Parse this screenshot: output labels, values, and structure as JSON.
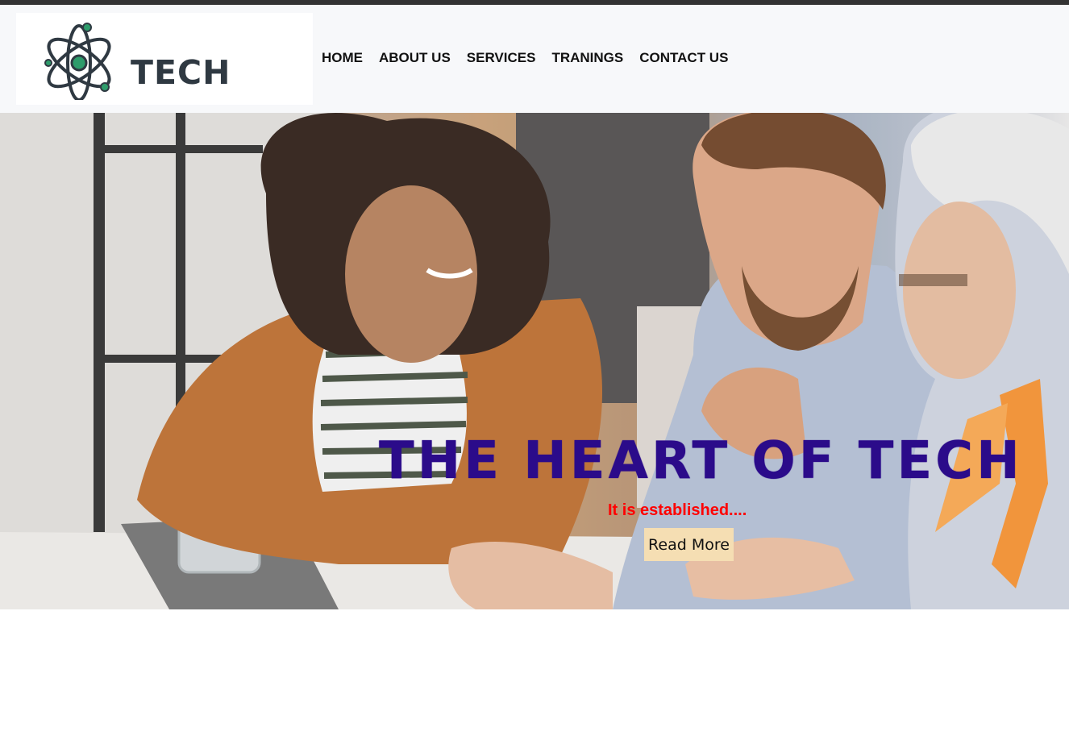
{
  "header": {
    "logo_text": "TECH",
    "nav": [
      {
        "label": "HOME"
      },
      {
        "label": "ABOUT US"
      },
      {
        "label": "SERVICES"
      },
      {
        "label": "TRANINGS"
      },
      {
        "label": "CONTACT US"
      }
    ]
  },
  "hero": {
    "title": "THE HEART OF TECH",
    "subtitle": "It is established....",
    "button_label": "Read More",
    "image": "photo of three people smiling at a laptop"
  },
  "colors": {
    "title": "#2b0b8a",
    "subtitle": "#ff0000",
    "button_bg": "#f5deb3",
    "logo_text": "#2f3942",
    "logo_accent": "#2e9c6b",
    "topbar": "#333333"
  }
}
